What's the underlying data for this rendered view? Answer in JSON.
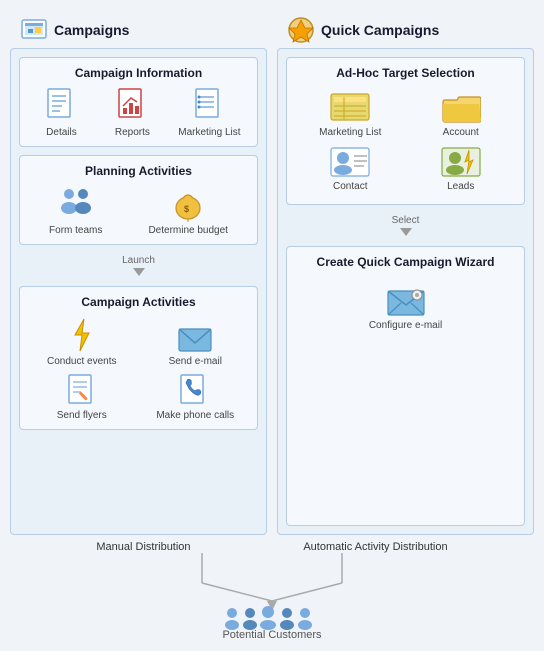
{
  "campaigns": {
    "title": "Campaigns",
    "campaign_info": {
      "title": "Campaign Information",
      "items": [
        {
          "label": "Details",
          "icon": "details-icon"
        },
        {
          "label": "Reports",
          "icon": "reports-icon"
        },
        {
          "label": "Marketing List",
          "icon": "marketing-list-icon"
        }
      ]
    },
    "planning": {
      "title": "Planning Activities",
      "items": [
        {
          "label": "Form teams",
          "icon": "form-teams-icon"
        },
        {
          "label": "Determine budget",
          "icon": "determine-budget-icon"
        }
      ]
    },
    "launch_label": "Launch",
    "campaign_activities": {
      "title": "Campaign Activities",
      "items": [
        {
          "label": "Conduct events",
          "icon": "conduct-events-icon"
        },
        {
          "label": "Send e-mail",
          "icon": "send-email-icon"
        },
        {
          "label": "Send flyers",
          "icon": "send-flyers-icon"
        },
        {
          "label": "Make phone calls",
          "icon": "make-phone-calls-icon"
        }
      ]
    }
  },
  "quick_campaigns": {
    "title": "Quick Campaigns",
    "adhoc": {
      "title": "Ad-Hoc Target Selection",
      "items": [
        {
          "label": "Marketing List",
          "icon": "adhoc-mktlist-icon"
        },
        {
          "label": "Account",
          "icon": "adhoc-account-icon"
        },
        {
          "label": "Contact",
          "icon": "adhoc-contact-icon"
        },
        {
          "label": "Leads",
          "icon": "adhoc-leads-icon"
        }
      ]
    },
    "select_label": "Select",
    "wizard": {
      "title": "Create Quick Campaign Wizard",
      "items": [
        {
          "label": "Configure e-mail",
          "icon": "configure-email-icon"
        }
      ]
    }
  },
  "bottom": {
    "manual_label": "Manual Distribution",
    "automatic_label": "Automatic Activity Distribution",
    "customers_label": "Potential Customers"
  }
}
